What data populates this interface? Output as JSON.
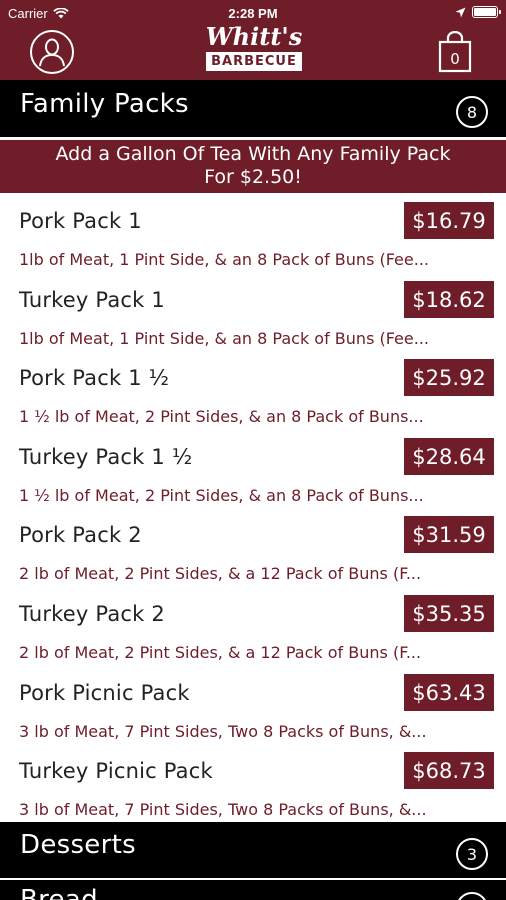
{
  "status_bar": {
    "carrier": "Carrier",
    "time": "2:28 PM"
  },
  "header": {
    "logo_script": "Whitt's",
    "logo_plate": "BARBECUE",
    "brand_color": "#6e1d29"
  },
  "sections": [
    {
      "title": "Family Packs",
      "count": "8"
    },
    {
      "title": "Desserts",
      "count": "3"
    },
    {
      "title": "Bread"
    }
  ],
  "promo": {
    "line1": "Add a Gallon Of Tea With Any Family Pack",
    "line2": "For $2.50!"
  },
  "items": [
    {
      "name": "Pork Pack 1",
      "price": "$16.79",
      "desc": "1lb of Meat, 1 Pint Side, & an 8 Pack of Buns (Fee..."
    },
    {
      "name": "Turkey Pack 1",
      "price": "$18.62",
      "desc": "1lb of Meat, 1 Pint Side, & an 8 Pack of Buns (Fee..."
    },
    {
      "name": "Pork Pack 1 ½",
      "price": "$25.92",
      "desc": "1 ½ lb of Meat, 2 Pint Sides, & an 8 Pack of Buns..."
    },
    {
      "name": "Turkey Pack 1 ½",
      "price": "$28.64",
      "desc": "1 ½ lb of Meat, 2 Pint Sides, & an 8 Pack of Buns..."
    },
    {
      "name": "Pork Pack 2",
      "price": "$31.59",
      "desc": "2 lb of Meat, 2 Pint Sides, & a 12 Pack of Buns (F..."
    },
    {
      "name": "Turkey Pack 2",
      "price": "$35.35",
      "desc": "2 lb of Meat, 2 Pint Sides, & a 12 Pack of Buns (F..."
    },
    {
      "name": "Pork Picnic Pack",
      "price": "$63.43",
      "desc": "3 lb of Meat, 7 Pint Sides, Two 8 Packs of Buns, &..."
    },
    {
      "name": "Turkey Picnic Pack",
      "price": "$68.73",
      "desc": "3 lb of Meat, 7 Pint Sides, Two 8 Packs of Buns, &..."
    }
  ],
  "icons": {
    "profile": "person-icon",
    "cart": "shopping-bag-icon",
    "cart_count": "0"
  }
}
